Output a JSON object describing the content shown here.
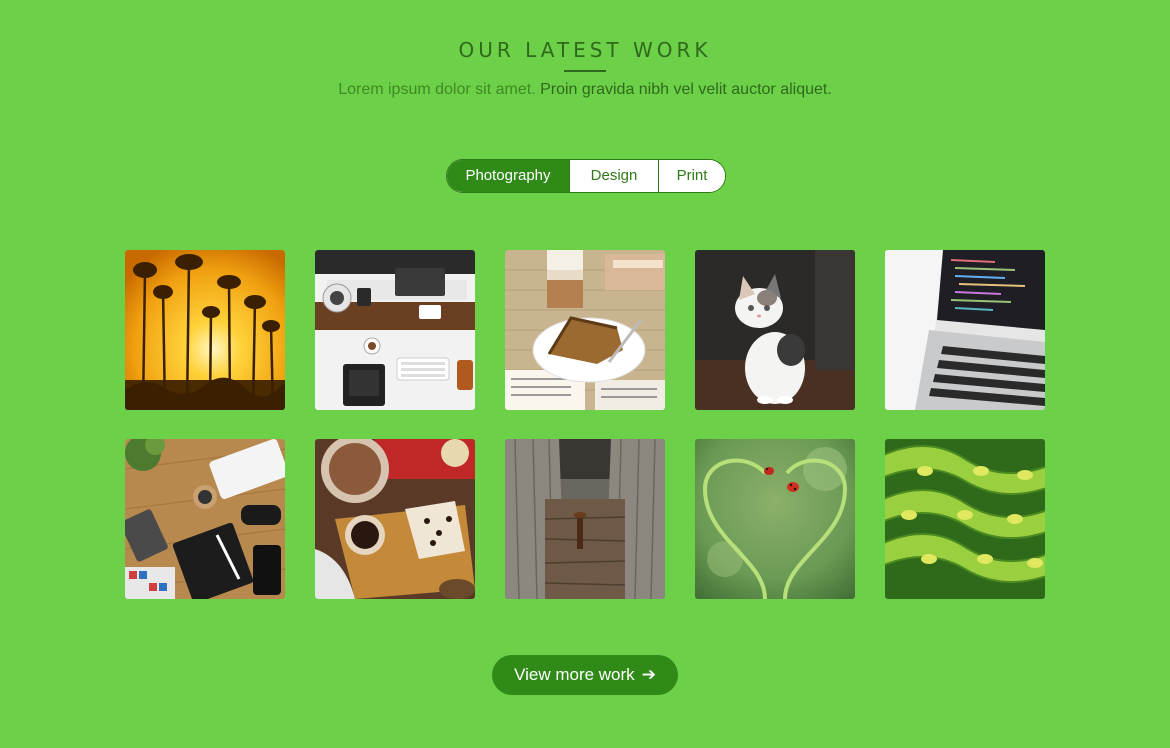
{
  "header": {
    "title": "OUR LATEST WORK",
    "subtitle_a": "Lorem ipsum dolor sit amet. ",
    "subtitle_b": "Proin gravida nibh vel velit auctor aliquet."
  },
  "tabs": [
    {
      "label": "Photography",
      "active": true
    },
    {
      "label": "Design",
      "active": false
    },
    {
      "label": "Print",
      "active": false
    }
  ],
  "gallery": [
    {
      "subject": "sunset-trees"
    },
    {
      "subject": "desk-workspace"
    },
    {
      "subject": "coffee-cake"
    },
    {
      "subject": "kitten"
    },
    {
      "subject": "laptop-code"
    },
    {
      "subject": "desk-flatlay"
    },
    {
      "subject": "baking-table"
    },
    {
      "subject": "wooden-plank-nail"
    },
    {
      "subject": "ladybug-heart-stems"
    },
    {
      "subject": "green-pods"
    }
  ],
  "cta": {
    "label": "View more work",
    "arrow": "➔"
  },
  "colors": {
    "background": "#6cd048",
    "accent": "#2f8a18",
    "heading": "#2f6a1c"
  }
}
